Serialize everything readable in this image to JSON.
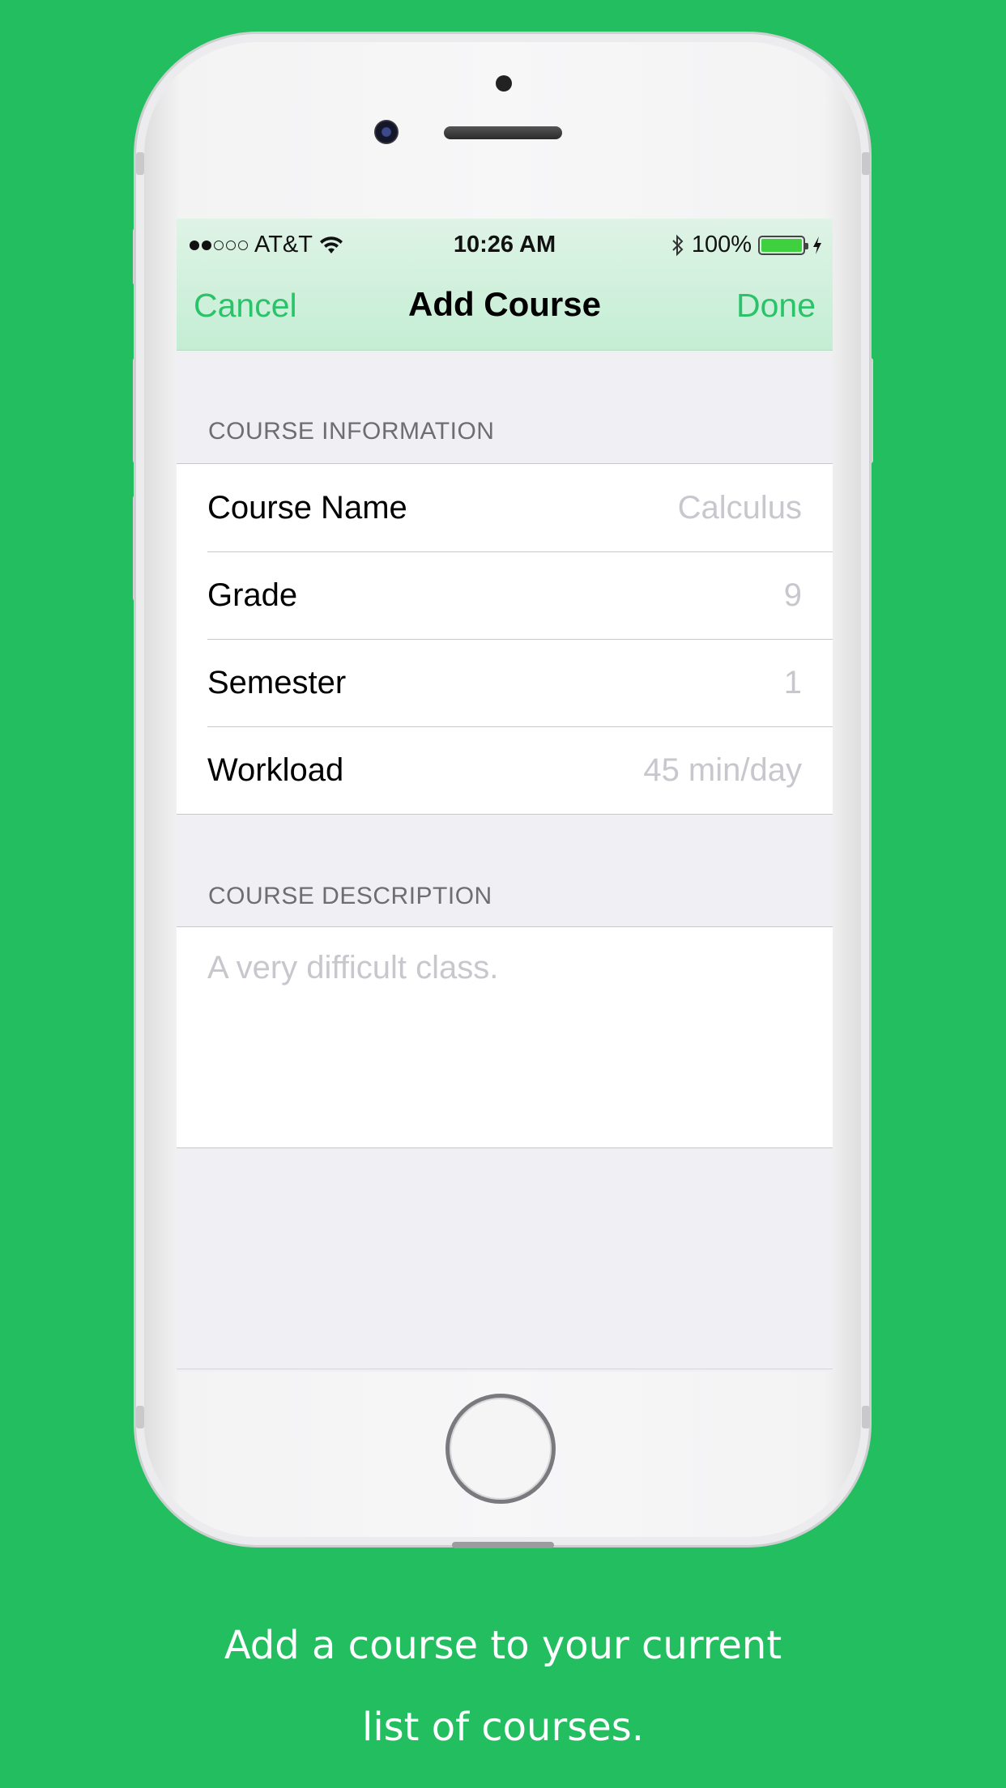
{
  "status_bar": {
    "carrier": "AT&T",
    "time": "10:26 AM",
    "battery": "100%",
    "signal_bars_filled": 2,
    "signal_bars_total": 5
  },
  "nav": {
    "cancel": "Cancel",
    "title": "Add Course",
    "done": "Done"
  },
  "sections": {
    "info_header": "COURSE INFORMATION",
    "rows": [
      {
        "label": "Course Name",
        "placeholder": "Calculus"
      },
      {
        "label": "Grade",
        "placeholder": "9"
      },
      {
        "label": "Semester",
        "placeholder": "1"
      },
      {
        "label": "Workload",
        "placeholder": "45 min/day"
      }
    ],
    "desc_header": "COURSE DESCRIPTION",
    "desc_placeholder": "A very difficult class."
  },
  "caption": {
    "line1": "Add a course to your current",
    "line2": "list of courses."
  },
  "colors": {
    "background": "#22BE5F",
    "accent": "#2BC36A"
  },
  "icons": [
    "wifi-icon",
    "bluetooth-icon",
    "battery-icon",
    "charging-icon"
  ]
}
